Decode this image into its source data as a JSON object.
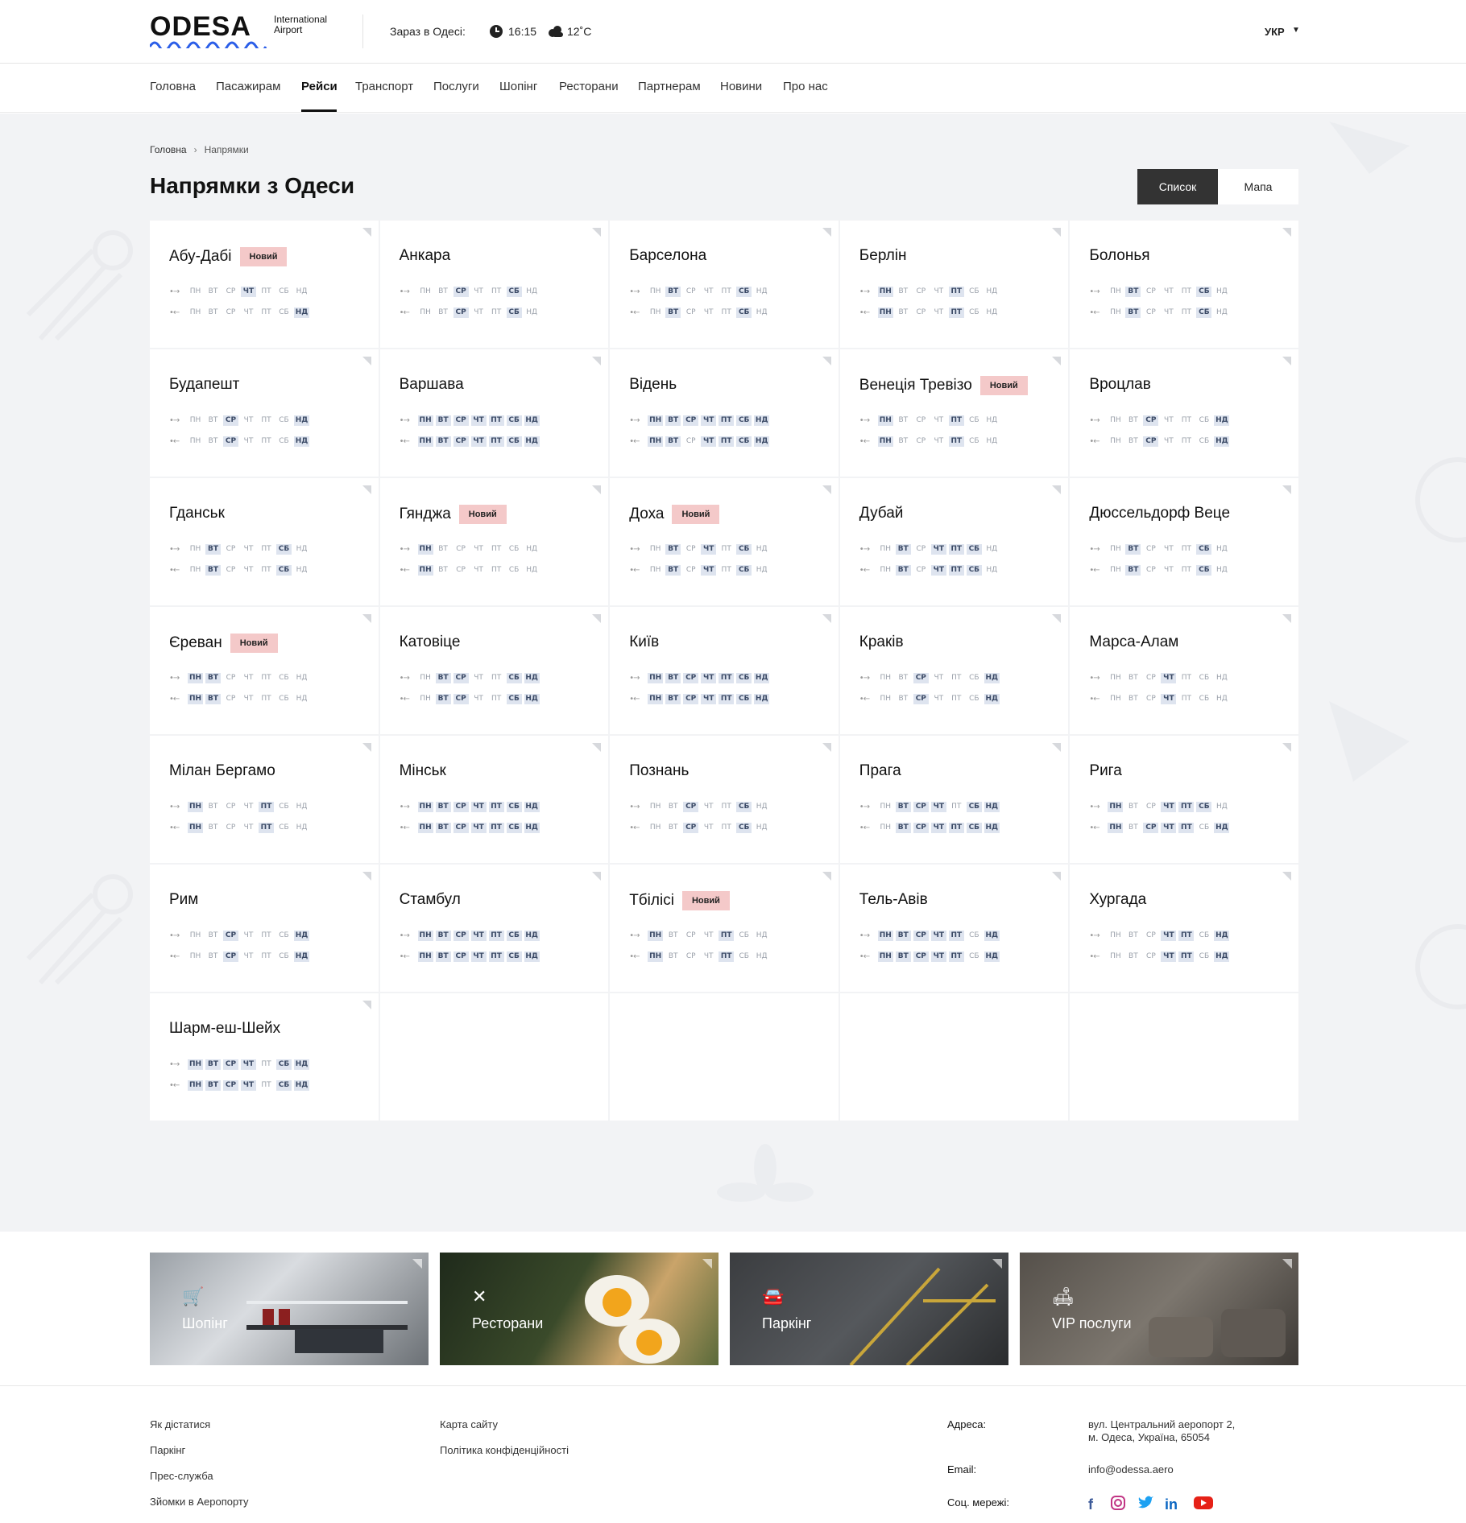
{
  "logo": {
    "word": "ODESA",
    "sub1": "International",
    "sub2": "Airport"
  },
  "header": {
    "now_label": "Зараз в Одесі:",
    "time": "16:15",
    "temp": "12˚C",
    "lang": "УКР"
  },
  "nav": [
    "Головна",
    "Пасажирам",
    "Рейси",
    "Транспорт",
    "Послуги",
    "Шопінг",
    "Ресторани",
    "Партнерам",
    "Новини",
    "Про нас"
  ],
  "nav_active": "Рейси",
  "breadcrumb": {
    "home": "Головна",
    "current": "Напрямки"
  },
  "page_title": "Напрямки з Одеси",
  "view_toggle": {
    "list": "Список",
    "map": "Мапа"
  },
  "badge_new": "Новий",
  "day_labels": [
    "ПН",
    "ВТ",
    "СР",
    "ЧТ",
    "ПТ",
    "СБ",
    "НД"
  ],
  "destinations": [
    {
      "city": "Абу-Дабі",
      "new": true,
      "out": "0001000",
      "ret": "0000001"
    },
    {
      "city": "Анкара",
      "new": false,
      "out": "0010010",
      "ret": "0010010"
    },
    {
      "city": "Барселона",
      "new": false,
      "out": "0100010",
      "ret": "0100010"
    },
    {
      "city": "Берлін",
      "new": false,
      "out": "1000100",
      "ret": "1000100"
    },
    {
      "city": "Болонья",
      "new": false,
      "out": "0100010",
      "ret": "0100010"
    },
    {
      "city": "Будапешт",
      "new": false,
      "out": "0010001",
      "ret": "0010001"
    },
    {
      "city": "Варшава",
      "new": false,
      "out": "1111111",
      "ret": "1111111"
    },
    {
      "city": "Відень",
      "new": false,
      "out": "1111111",
      "ret": "1101111"
    },
    {
      "city": "Венеція Тревізо",
      "new": true,
      "out": "1000100",
      "ret": "1000100"
    },
    {
      "city": "Вроцлав",
      "new": false,
      "out": "0010001",
      "ret": "0010001"
    },
    {
      "city": "Гданськ",
      "new": false,
      "out": "0100010",
      "ret": "0100010"
    },
    {
      "city": "Гянджа",
      "new": true,
      "out": "1000000",
      "ret": "1000000"
    },
    {
      "city": "Доха",
      "new": true,
      "out": "0101010",
      "ret": "0101010"
    },
    {
      "city": "Дубай",
      "new": false,
      "out": "0101110",
      "ret": "0101110"
    },
    {
      "city": "Дюссельдорф Веце",
      "new": false,
      "out": "0100010",
      "ret": "0100010"
    },
    {
      "city": "Єреван",
      "new": true,
      "out": "1100000",
      "ret": "1100000"
    },
    {
      "city": "Катовіце",
      "new": false,
      "out": "0110011",
      "ret": "0110011"
    },
    {
      "city": "Київ",
      "new": false,
      "out": "1111111",
      "ret": "1111111"
    },
    {
      "city": "Краків",
      "new": false,
      "out": "0010001",
      "ret": "0010001"
    },
    {
      "city": "Марса-Алам",
      "new": false,
      "out": "0001000",
      "ret": "0001000"
    },
    {
      "city": "Мілан Бергамо",
      "new": false,
      "out": "1000100",
      "ret": "1000100"
    },
    {
      "city": "Мінськ",
      "new": false,
      "out": "1111111",
      "ret": "1111111"
    },
    {
      "city": "Познань",
      "new": false,
      "out": "0010010",
      "ret": "0010010"
    },
    {
      "city": "Прага",
      "new": false,
      "out": "0111011",
      "ret": "0111111"
    },
    {
      "city": "Рига",
      "new": false,
      "out": "1001110",
      "ret": "1011101"
    },
    {
      "city": "Рим",
      "new": false,
      "out": "0010001",
      "ret": "0010001"
    },
    {
      "city": "Стамбул",
      "new": false,
      "out": "1111111",
      "ret": "1111111"
    },
    {
      "city": "Тбілісі",
      "new": true,
      "out": "1000100",
      "ret": "1000100"
    },
    {
      "city": "Тель-Авів",
      "new": false,
      "out": "1111101",
      "ret": "1111101"
    },
    {
      "city": "Хургада",
      "new": false,
      "out": "0001101",
      "ret": "0001101"
    },
    {
      "city": "Шарм-еш-Шейх",
      "new": false,
      "out": "1111011",
      "ret": "1111011"
    }
  ],
  "promos": [
    {
      "label": "Шопінг",
      "icon": "cart-icon"
    },
    {
      "label": "Ресторани",
      "icon": "cutlery-icon"
    },
    {
      "label": "Паркінг",
      "icon": "car-icon"
    },
    {
      "label": "VIP послуги",
      "icon": "sofa-icon"
    }
  ],
  "footer": {
    "col1": [
      "Як дістатися",
      "Паркінг",
      "Прес-служба",
      "Зйомки в Аеропорту"
    ],
    "col2": [
      "Карта сайту",
      "Політика конфіденційності"
    ],
    "address_label": "Адреса:",
    "address_line1": "вул. Центральний аеропорт 2,",
    "address_line2": "м. Одеса, Україна, 65054",
    "email_label": "Email:",
    "email": "info@odessa.aero",
    "social_label": "Соц. мережі:",
    "socials": [
      "facebook-icon",
      "instagram-icon",
      "twitter-icon",
      "linkedin-icon",
      "youtube-icon"
    ]
  },
  "colors": {
    "badge_bg": "#f4c9c9",
    "day_active_bg": "#dee4ef",
    "page_bg": "#f2f3f5",
    "toggle_active": "#333333"
  }
}
